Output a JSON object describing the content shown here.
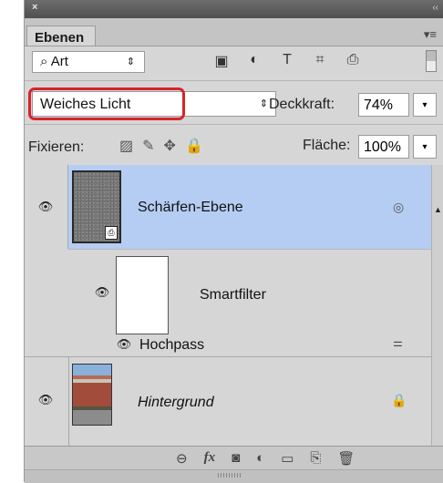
{
  "panel": {
    "tab": "Ebenen",
    "close_glyph": "×",
    "collapse_glyph": "‹‹",
    "menu_glyph": "▾≡"
  },
  "filterbar": {
    "kind_value": "Art",
    "search_glyph": "⌕",
    "arrows": "⇕",
    "icons": [
      "pixel-layer-filter-icon",
      "adjustment-filter-icon",
      "type-filter-icon",
      "shape-filter-icon",
      "smartobject-filter-icon"
    ],
    "icon_glyphs": [
      "▣",
      "◐",
      "T",
      "⌗",
      "⎙"
    ]
  },
  "blend": {
    "mode": "Weiches Licht",
    "arrows": "⇕",
    "opacity_label": "Deckkraft:",
    "opacity_value": "74%",
    "btn_glyph": "▾"
  },
  "lock": {
    "label": "Fixieren:",
    "icons": [
      "lock-transparency-icon",
      "lock-image-icon",
      "lock-position-icon",
      "lock-all-icon"
    ],
    "icon_glyphs": [
      "▨",
      "✎",
      "✥",
      "🔒"
    ],
    "fill_label": "Fläche:",
    "fill_value": "100%",
    "btn_glyph": "▾"
  },
  "layers": [
    {
      "name": "Schärfen-Ebene",
      "selected": true,
      "visible": true,
      "italic": false
    },
    {
      "name": "Smartfilter",
      "selected": false,
      "visible": true,
      "italic": false
    },
    {
      "name": "Hochpass",
      "selected": false,
      "visible": true,
      "italic": false
    },
    {
      "name": "Hintergrund",
      "selected": false,
      "visible": true,
      "italic": true
    }
  ],
  "glyphs": {
    "eye": "👁",
    "smart": "◎",
    "scroll_up": "▲",
    "filter_opts": "⚌",
    "lock": "🔒"
  },
  "bottom": {
    "icons": [
      "link-layers-icon",
      "fx-icon",
      "mask-icon",
      "adjustment-icon",
      "group-icon",
      "new-layer-icon",
      "trash-icon"
    ],
    "icon_glyphs": [
      "⊖",
      "fx",
      "◙",
      "◐",
      "▭",
      "⎘",
      "🗑"
    ]
  }
}
